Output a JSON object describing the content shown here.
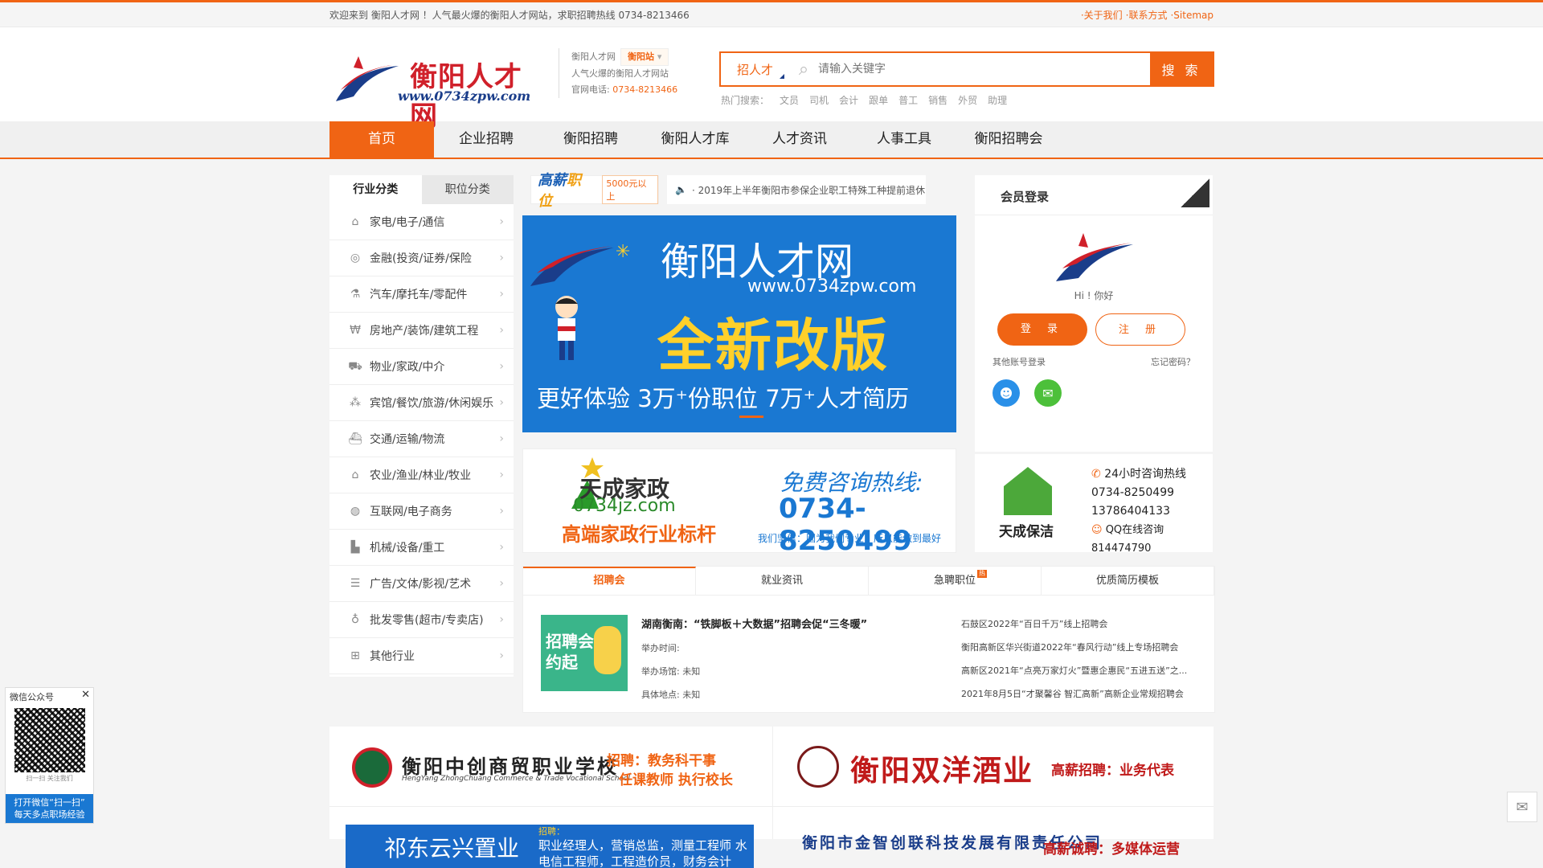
{
  "topbar": {
    "welcome": "欢迎来到 衡阳人才网 ！人气最火爆的衡阳人才网站，求职招聘热线 0734-8213466",
    "links": [
      "·关于我们",
      "·联系方式",
      "·Sitemap"
    ]
  },
  "header": {
    "logo_text": "衡阳人才网",
    "logo_url": "www.0734zpw.com",
    "site_name": "衡阳人才网",
    "station": "衡阳站",
    "tagline": "人气火爆的衡阳人才网站",
    "phone_label": "官网电话:",
    "phone": "0734-8213466"
  },
  "search": {
    "category": "招人才",
    "placeholder": "请输入关键字",
    "button": "搜 索",
    "hot_label": "热门搜索：",
    "hot": [
      "文员",
      "司机",
      "会计",
      "跟单",
      "普工",
      "销售",
      "外贸",
      "助理"
    ]
  },
  "nav": [
    "首页",
    "企业招聘",
    "衡阳招聘",
    "衡阳人才库",
    "人才资讯",
    "人事工具",
    "衡阳招聘会"
  ],
  "left": {
    "tabs": [
      "行业分类",
      "职位分类"
    ],
    "items": [
      {
        "label": "家电/电子/通信",
        "icon": "home-appliance-icon"
      },
      {
        "label": "金融(投资/证券/保险",
        "icon": "coins-icon"
      },
      {
        "label": "汽车/摩托车/零配件",
        "icon": "flask-icon"
      },
      {
        "label": "房地产/装饰/建筑工程",
        "icon": "yuan-icon"
      },
      {
        "label": "物业/家政/中介",
        "icon": "truck-icon"
      },
      {
        "label": "宾馆/餐饮/旅游/休闲娱乐",
        "icon": "molecule-icon"
      },
      {
        "label": "交通/运输/物流",
        "icon": "ship-icon"
      },
      {
        "label": "农业/渔业/林业/牧业",
        "icon": "house-icon"
      },
      {
        "label": "互联网/电子商务",
        "icon": "globe-icon"
      },
      {
        "label": "机械/设备/重工",
        "icon": "factory-icon"
      },
      {
        "label": "广告/文体/影视/艺术",
        "icon": "list-icon"
      },
      {
        "label": "批发零售(超市/专卖店)",
        "icon": "bottle-icon"
      },
      {
        "label": "其他行业",
        "icon": "network-icon"
      }
    ]
  },
  "strip": {
    "title_a": "高薪",
    "title_b": "职位",
    "salary": "5000元以上",
    "notice": "· 2019年上半年衡阳市参保企业职工特殊工种提前退休..."
  },
  "hero": {
    "title": "衡阳人才网",
    "url": "www.0734zpw.com",
    "headline": "全新改版",
    "sub": "更好体验 3万⁺份职位 7万⁺人才简历"
  },
  "ad_jz": {
    "name": "天成家政",
    "domain": "0734jz.com",
    "slogan": "高端家政行业标杆",
    "hotline_label": "免费咨询热线:",
    "hotline": "0734-8250499",
    "promise": "我们坚信：因为我们专业，所以能做到最好"
  },
  "login": {
    "title": "会员登录",
    "hi": "Hi ! 你好",
    "login": "登 录",
    "register": "注 册",
    "other": "其他账号登录",
    "forgot": "忘记密码？"
  },
  "ad_clean": {
    "name": "天成保洁",
    "hotline_label": "24小时咨询热线",
    "phone1": "0734-8250499",
    "phone2": "13786404133",
    "qq_label": "QQ在线咨询",
    "qq": "814474790"
  },
  "news_tabs": {
    "tabs": [
      "招聘会",
      "就业资讯",
      "急聘职位",
      "优质简历模板"
    ],
    "badge": "热",
    "image_text": "招聘会 约起",
    "featured_title": "湖南衡南：“铁脚板＋大数据”招聘会促“三冬暖”",
    "time": "举办时间:",
    "venue": "举办场馆:  未知",
    "place": "具体地点:  未知",
    "list": [
      "石鼓区2022年“百日千万”线上招聘会",
      "衡阳高新区华兴街道2022年“春风行动”线上专场招聘会",
      "高新区2021年“点亮万家灯火”暨惠企惠民“五进五送”之...",
      "2021年8月5日“才聚馨谷 智汇高新”高新企业常规招聘会"
    ]
  },
  "bottom_ads": {
    "a_name": "衡阳中创商贸职业学校",
    "a_sub": "HengYang ZhongChuang Commerce & Trade Vocational School",
    "a_hire1": "招聘：教务科干事",
    "a_hire2": "任课教师   执行校长",
    "b_name": "衡阳双洋酒业",
    "b_hire": "高薪招聘：业务代表",
    "c_name": "祁东云兴置业",
    "c_hire_label": "招聘：",
    "c_hire": "职业经理人，营销总监，测量工程师 水电信工程师，工程造价员，财务会计",
    "d_name": "衡阳市金智创联科技发展有限责任公司",
    "d_hire": "高薪诚聘：多媒体运营"
  },
  "wechat": {
    "title": "微信公众号",
    "caption": "扫一扫 关注我们",
    "footer1": "打开微信“扫一扫”",
    "footer2": "每天多点职场经验"
  }
}
